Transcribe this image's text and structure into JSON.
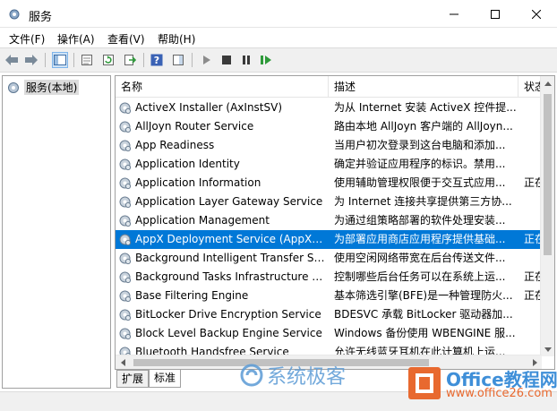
{
  "window": {
    "title": "服务"
  },
  "menu": [
    {
      "label": "文件(F)"
    },
    {
      "label": "操作(A)"
    },
    {
      "label": "查看(V)"
    },
    {
      "label": "帮助(H)"
    }
  ],
  "tree": {
    "item": "服务(本地)"
  },
  "table": {
    "columns": [
      "名称",
      "描述",
      "状态"
    ],
    "rows": [
      {
        "name": "ActiveX Installer (AxInstSV)",
        "desc": "为从 Internet 安装 ActiveX 控件提...",
        "status": ""
      },
      {
        "name": "AllJoyn Router Service",
        "desc": "路由本地 AllJoyn 客户端的 AllJoyn...",
        "status": ""
      },
      {
        "name": "App Readiness",
        "desc": "当用户初次登录到这台电脑和添加...",
        "status": ""
      },
      {
        "name": "Application Identity",
        "desc": "确定并验证应用程序的标识。禁用...",
        "status": ""
      },
      {
        "name": "Application Information",
        "desc": "使用辅助管理权限便于交互式应用...",
        "status": "正在"
      },
      {
        "name": "Application Layer Gateway Service",
        "desc": "为 Internet 连接共享提供第三方协...",
        "status": ""
      },
      {
        "name": "Application Management",
        "desc": "为通过组策略部署的软件处理安装...",
        "status": ""
      },
      {
        "name": "AppX Deployment Service (AppXS...",
        "desc": "为部署应用商店应用程序提供基础...",
        "status": "正在"
      },
      {
        "name": "Background Intelligent Transfer Se...",
        "desc": "使用空闲网络带宽在后台传送文件...",
        "status": ""
      },
      {
        "name": "Background Tasks Infrastructure S...",
        "desc": "控制哪些后台任务可以在系统上运...",
        "status": "正在"
      },
      {
        "name": "Base Filtering Engine",
        "desc": "基本筛选引擎(BFE)是一种管理防火...",
        "status": "正在"
      },
      {
        "name": "BitLocker Drive Encryption Service",
        "desc": "BDESVC 承载 BitLocker 驱动器加...",
        "status": ""
      },
      {
        "name": "Block Level Backup Engine Service",
        "desc": "Windows 备份使用 WBENGINE 服...",
        "status": ""
      },
      {
        "name": "Bluetooth Handsfree Service",
        "desc": "允许无线蓝牙耳机在此计算机上运...",
        "status": ""
      }
    ],
    "selected_index": 7
  },
  "tabs": [
    {
      "label": "扩展"
    },
    {
      "label": "标准"
    }
  ],
  "watermark": {
    "text": "系统极客"
  },
  "brand": {
    "name": "Office教程网",
    "url": "www.office26.com"
  },
  "colors": {
    "selection": "#0078d7",
    "accent_blue": "#3f8fd8",
    "accent_orange": "#e8692f"
  }
}
